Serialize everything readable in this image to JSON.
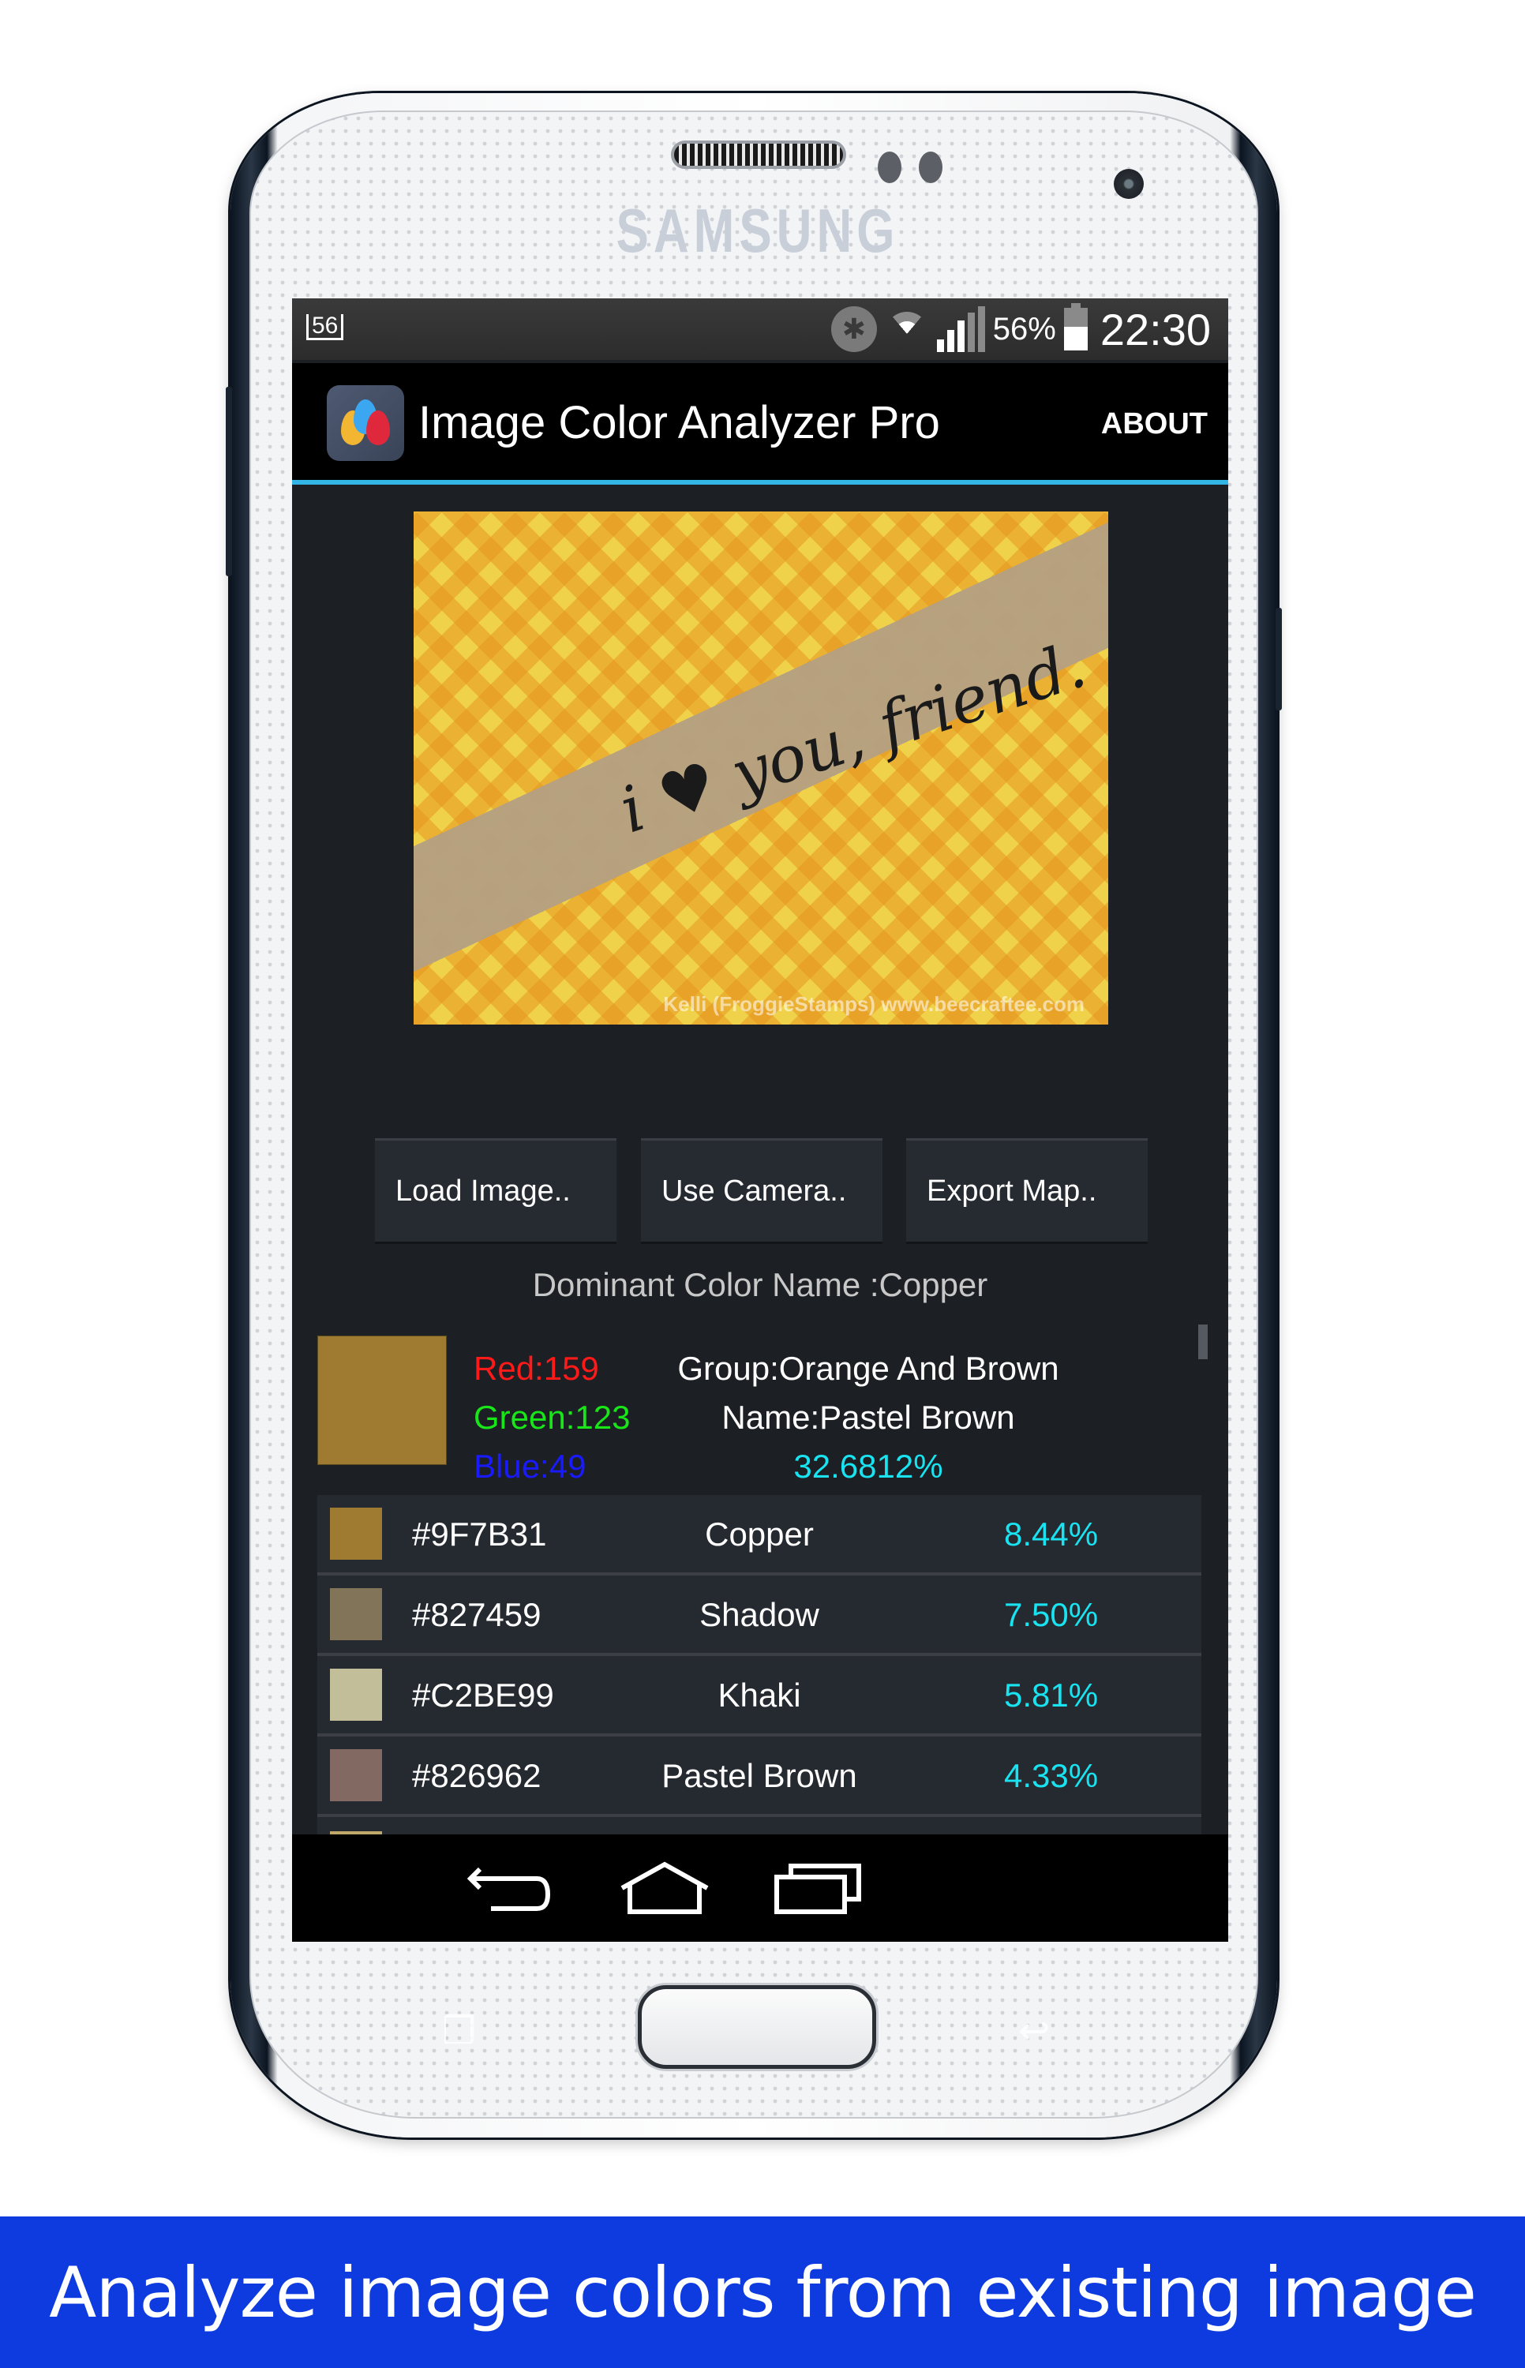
{
  "device": {
    "brand": "SAMSUNG"
  },
  "status_bar": {
    "notification_badge": "56",
    "battery_percent": "56%",
    "battery_level": 0.56,
    "time": "22:30",
    "icons": [
      "bluetooth-icon",
      "wifi-icon",
      "signal-icon",
      "battery-icon"
    ]
  },
  "action_bar": {
    "title": "Image Color Analyzer Pro",
    "about_label": "ABOUT",
    "accent_color": "#33b5e5"
  },
  "preview_image": {
    "description": "Craft card photo with yellow gingham paper and banner",
    "banner_text": "i ♥ you, friend.",
    "watermark": "Kelli (FroggieStamps) www.beecraftee.com"
  },
  "buttons": {
    "load_image": "Load Image..",
    "use_camera": "Use Camera..",
    "export_map": "Export Map.."
  },
  "dominant": {
    "label": "Dominant Color Name :Copper",
    "swatch_color": "#9F7B31",
    "red": "Red:159",
    "green": "Green:123",
    "blue": "Blue:49",
    "group": "Group:Orange And Brown",
    "name": "Name:Pastel Brown",
    "percent": "32.6812%"
  },
  "colors": [
    {
      "hex": "#9F7B31",
      "name": "Copper",
      "percent": "8.44%"
    },
    {
      "hex": "#827459",
      "name": "Shadow",
      "percent": "7.50%"
    },
    {
      "hex": "#C2BE99",
      "name": "Khaki",
      "percent": "5.81%"
    },
    {
      "hex": "#826962",
      "name": "Pastel Brown",
      "percent": "4.33%"
    }
  ],
  "partial_row_swatch": "#BFA86A",
  "nav_bar": {
    "icons": [
      "back-icon",
      "home-icon",
      "recent-apps-icon"
    ]
  },
  "caption": "Analyze image colors from existing image"
}
